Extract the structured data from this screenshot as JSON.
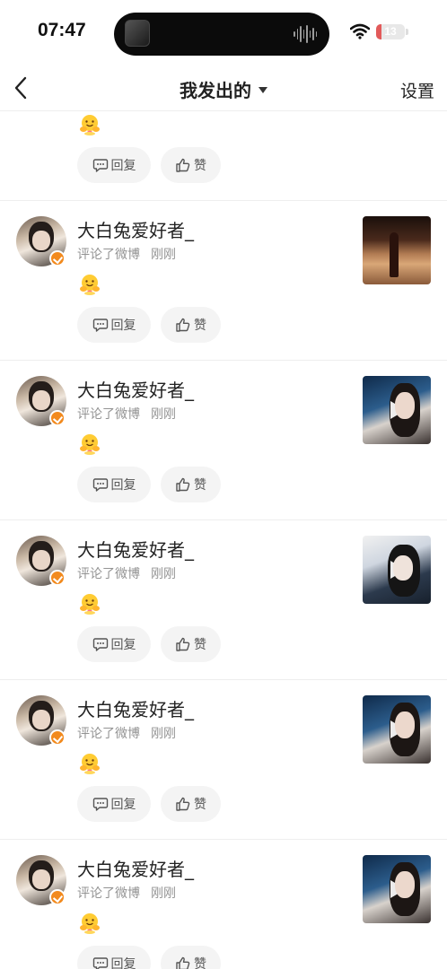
{
  "status_bar": {
    "time": "07:47",
    "battery": "13",
    "battery_level": 0.13
  },
  "nav": {
    "title": "我发出的",
    "settings": "设置"
  },
  "first_item": {
    "reply": "回复",
    "like": "赞"
  },
  "items": [
    {
      "username": "大白兔爱好者_",
      "action": "评论了微博",
      "time": "刚刚",
      "reply": "回复",
      "like": "赞"
    },
    {
      "username": "大白兔爱好者_",
      "action": "评论了微博",
      "time": "刚刚",
      "reply": "回复",
      "like": "赞"
    },
    {
      "username": "大白兔爱好者_",
      "action": "评论了微博",
      "time": "刚刚",
      "reply": "回复",
      "like": "赞"
    },
    {
      "username": "大白兔爱好者_",
      "action": "评论了微博",
      "time": "刚刚",
      "reply": "回复",
      "like": "赞"
    },
    {
      "username": "大白兔爱好者_",
      "action": "评论了微博",
      "time": "刚刚",
      "reply": "回复",
      "like": "赞"
    }
  ],
  "icons": {
    "back": "chevron-left-icon",
    "caret": "caret-down-icon",
    "wifi": "wifi-icon",
    "reply": "comment-bubble-icon",
    "like": "thumbs-up-icon",
    "play": "play-icon",
    "emoji": "hug-emoji-icon",
    "verified": "verified-badge-icon"
  },
  "colors": {
    "accent": "#f28a1e",
    "battery_low": "#e25a5a",
    "meta_text": "#939393",
    "button_bg": "#f4f4f4"
  }
}
